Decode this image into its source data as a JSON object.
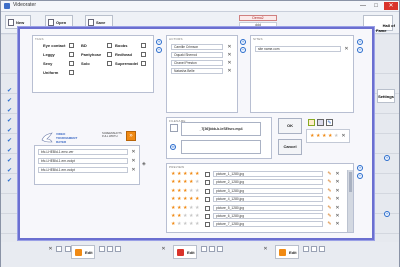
{
  "window": {
    "title": "Videorater",
    "min_label": "—",
    "max_label": "□",
    "close_label": "✕"
  },
  "toolbar": {
    "new_db": "New DB",
    "open_db": "Open DB",
    "save_as": "Save As...",
    "tag_labels": [
      "Demo2",
      "ddd"
    ],
    "hall_of_fame": "Hall of\nFame",
    "settings": "Settings"
  },
  "panels": {
    "tags_title": "TAGS",
    "actors_title": "ACTORS",
    "sites_title": "SITES",
    "filename_title": "FILENAME",
    "preview_title": "PREVIEW"
  },
  "tags": [
    {
      "label": "Eye contact"
    },
    {
      "label": "BD"
    },
    {
      "label": "Boobs"
    },
    {
      "label": "Leggy"
    },
    {
      "label": "Pantyhose"
    },
    {
      "label": "Redhead"
    },
    {
      "label": "Sexy"
    },
    {
      "label": "Solo"
    },
    {
      "label": "Supermodel"
    },
    {
      "label": "Uniform"
    }
  ],
  "actors": [
    "Camille Crimson",
    "Oquaki Sherrod",
    "Chanel Preston",
    "Natasha Belle"
  ],
  "sites": [
    "site name.com"
  ],
  "logo": {
    "line1": "VIDEO",
    "line2": "TOURNAMENT",
    "line3": "RATER"
  },
  "screenshots_label": "SCREENSHOTS\nFULL WIDTH",
  "filename_value": "_7[36]bbb-b-leSEtsrc.mp4",
  "ok_label": "OK",
  "cancel_label": "Cancel",
  "files_left": [
    "bfc-LHEBld-1.ernc.ver",
    "bfc-LHEBld-1.em.vcdpt",
    "bfc-LHEBld-1.em.vcdpt"
  ],
  "preview_files": [
    {
      "name": "picture_1_1280.jpg",
      "stars": 5
    },
    {
      "name": "picture_2_1280.jpg",
      "stars": 4
    },
    {
      "name": "picture_3_1280.jpg",
      "stars": 3
    },
    {
      "name": "picture_4_1280.jpg",
      "stars": 5
    },
    {
      "name": "picture_5_1280.jpg",
      "stars": 3
    },
    {
      "name": "picture_6_1280.jpg",
      "stars": 2
    },
    {
      "name": "picture_7_1280.jpg",
      "stars": 1
    }
  ],
  "rating_stars": 4,
  "bottom_bar": {
    "edit_label": "Edit"
  }
}
